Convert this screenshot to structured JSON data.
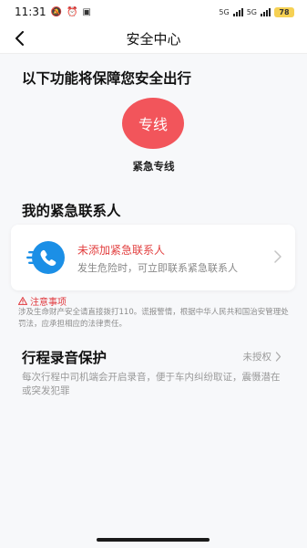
{
  "status_bar": {
    "time": "11:31",
    "battery": "78",
    "network_1": "5G",
    "network_2": "5G"
  },
  "header": {
    "title": "安全中心",
    "back_icon": "chevron-left-icon"
  },
  "features": {
    "title": "以下功能将保障您安全出行",
    "express_button_text": "专线",
    "express_label": "紧急专线",
    "express_color": "#f2555b"
  },
  "contacts": {
    "title": "我的紧急联系人",
    "card_title": "未添加紧急联系人",
    "card_desc": "发生危险时，可立即联系紧急联系人",
    "icon": "phone-icon",
    "icon_color": "#1b8fe6",
    "warning_color": "#e23f3f"
  },
  "notice": {
    "title": "注意事项",
    "icon": "warning-triangle-icon",
    "text": "涉及生命财产安全请直接拨打110。谎报警情，根据中华人民共和国治安管理处罚法，应承担相应的法律责任。"
  },
  "recording": {
    "title": "行程录音保护",
    "status": "未授权",
    "description": "每次行程中司机端会开启录音，便于车内纠纷取证，震慑潜在或突发犯罪"
  }
}
